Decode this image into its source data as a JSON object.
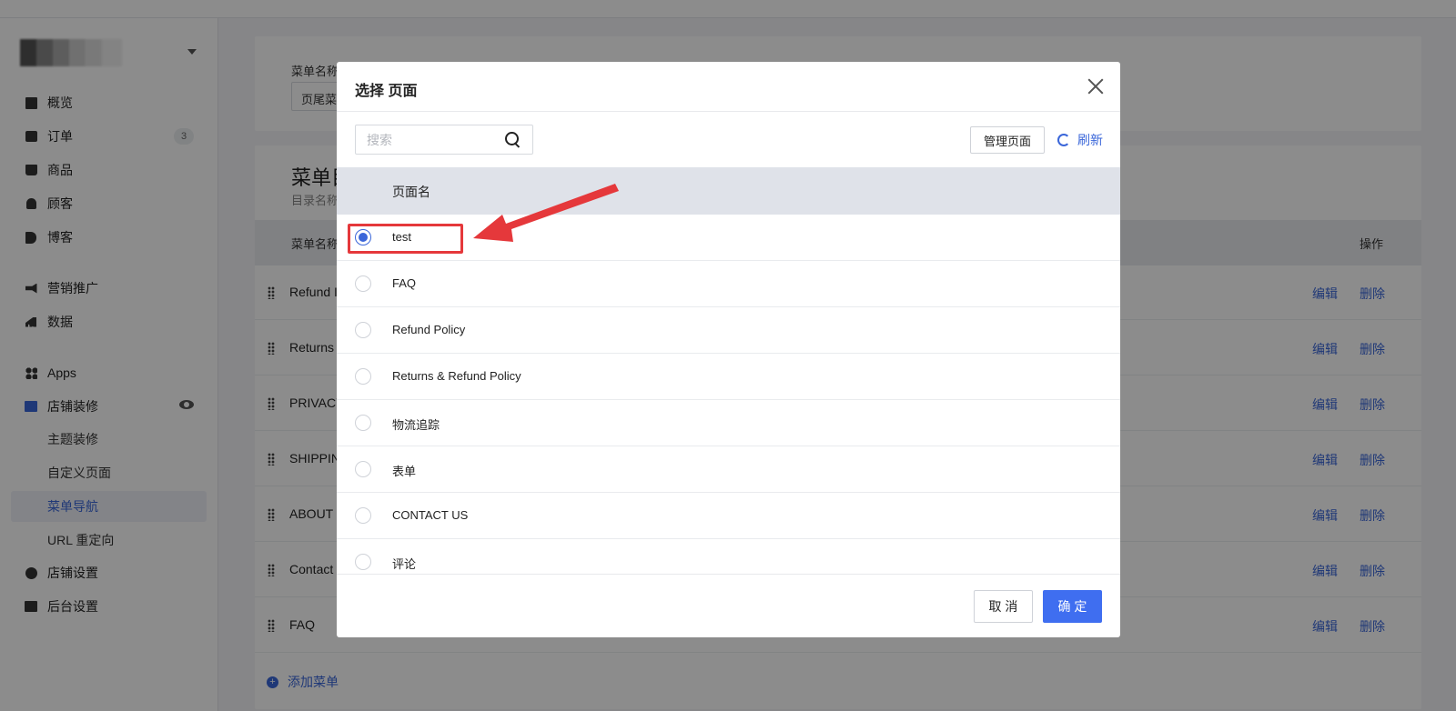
{
  "sidebar": {
    "items": [
      {
        "label": "概览",
        "icon": "dashboard-icon"
      },
      {
        "label": "订单",
        "icon": "inbox-icon",
        "badge": "3"
      },
      {
        "label": "商品",
        "icon": "bag-icon"
      },
      {
        "label": "顾客",
        "icon": "user-icon"
      },
      {
        "label": "博客",
        "icon": "blog-icon"
      },
      {
        "label": "营销推广",
        "icon": "megaphone-icon"
      },
      {
        "label": "数据",
        "icon": "bar-chart-icon"
      },
      {
        "label": "Apps",
        "icon": "apps-icon"
      },
      {
        "label": "店铺装修",
        "icon": "store-icon"
      },
      {
        "label": "主题装修"
      },
      {
        "label": "自定义页面"
      },
      {
        "label": "菜单导航"
      },
      {
        "label": "URL 重定向"
      },
      {
        "label": "店铺设置",
        "icon": "gear-icon"
      },
      {
        "label": "后台设置",
        "icon": "server-icon"
      }
    ]
  },
  "background": {
    "menu_name_label": "菜单名称",
    "menu_name_value": "页尾菜",
    "section_title": "菜单目",
    "section_sub": "目录名称",
    "col_name": "菜单名称",
    "col_action": "操作",
    "rows": [
      "Refund I",
      "Returns",
      "PRIVACY",
      "SHIPPIN",
      "ABOUT",
      "Contact",
      "FAQ"
    ],
    "edit_label": "编辑",
    "delete_label": "删除",
    "add_menu": "添加菜单"
  },
  "modal": {
    "title": "选择 页面",
    "search_placeholder": "搜索",
    "manage_label": "管理页面",
    "refresh_label": "刷新",
    "column_header": "页面名",
    "pages": [
      {
        "name": "test",
        "checked": true
      },
      {
        "name": "FAQ",
        "checked": false
      },
      {
        "name": "Refund Policy",
        "checked": false
      },
      {
        "name": "Returns & Refund Policy",
        "checked": false
      },
      {
        "name": "物流追踪",
        "checked": false
      },
      {
        "name": "表单",
        "checked": false
      },
      {
        "name": "CONTACT US",
        "checked": false
      },
      {
        "name": "评论",
        "checked": false
      }
    ],
    "cancel_label": "取 消",
    "ok_label": "确 定"
  },
  "colors": {
    "accent": "#3f6ef0",
    "link": "#3a66d9",
    "annotation": "#e5383b"
  }
}
